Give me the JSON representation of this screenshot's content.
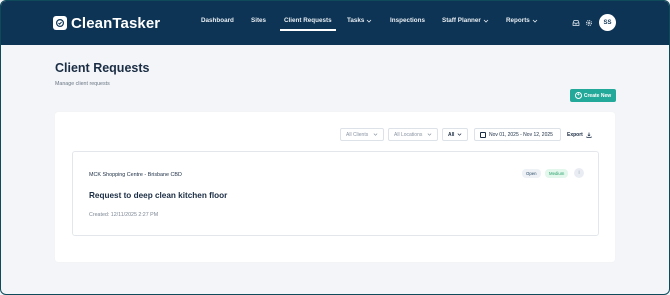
{
  "app": {
    "name": "CleanTasker",
    "user_initials": "SS"
  },
  "nav": {
    "items": [
      {
        "label": "Dashboard"
      },
      {
        "label": "Sites"
      },
      {
        "label": "Client Requests"
      },
      {
        "label": "Tasks"
      },
      {
        "label": "Inspections"
      },
      {
        "label": "Staff Planner"
      },
      {
        "label": "Reports"
      }
    ],
    "active": "Client Requests"
  },
  "page": {
    "title": "Client Requests",
    "subtitle": "Manage client requests",
    "create_label": "Create New"
  },
  "filters": {
    "clients": "All Clients",
    "locations": "All Locations",
    "status": "All",
    "date_range": "Nov 01, 2025 - Nov 12, 2025",
    "export_label": "Export"
  },
  "requests": [
    {
      "site": "MCK Shopping Centre - Brisbane CBD",
      "title": "Request to deep clean kitchen floor",
      "created": "Created: 12/11/2025 2:27 PM",
      "status": "Open",
      "priority": "Medium"
    }
  ],
  "colors": {
    "nav_bg": "#0d3454",
    "accent": "#23a99a",
    "priority_medium": "#25a06a"
  }
}
